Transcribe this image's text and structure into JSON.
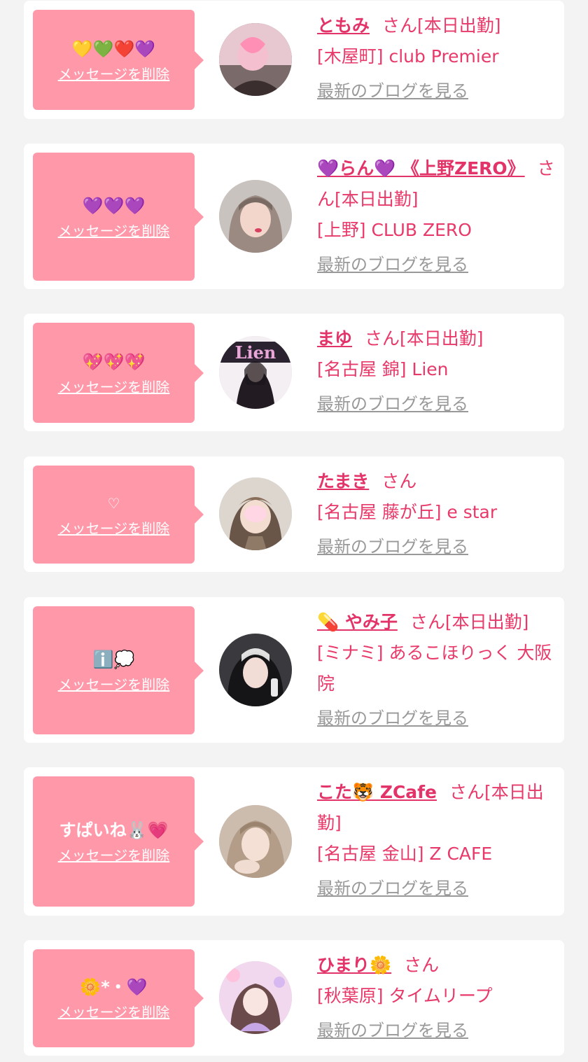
{
  "delete_label": "メッセージを削除",
  "blog_label": "最新のブログを見る",
  "cards": [
    {
      "message": "💛💚❤️💜",
      "name": "ともみ",
      "san": "さん",
      "status": "[本日出勤]",
      "shop": "[木屋町] club Premier"
    },
    {
      "message": "💜💜💜",
      "name": "💜らん💜 《上野ZERO》",
      "san": "さん",
      "status": "[本日出勤]",
      "shop": "[上野] CLUB ZERO"
    },
    {
      "message": "💖💖💖",
      "name": "まゆ",
      "san": "さん",
      "status": "[本日出勤]",
      "shop": "[名古屋 錦] Lien"
    },
    {
      "message": "♡",
      "name": "たまき",
      "san": "さん",
      "status": "",
      "shop": "[名古屋 藤が丘] e star"
    },
    {
      "message": "ℹ️💭",
      "name": "💊 やみ子",
      "san": "さん",
      "status": "[本日出勤]",
      "shop": "[ミナミ] あるこほりっく 大阪院"
    },
    {
      "message": "すぱいね🐰💗",
      "name": "こた🐯 ZCafe",
      "san": "さん",
      "status": "[本日出勤]",
      "shop": "[名古屋 金山] Z CAFE"
    },
    {
      "message": "🌼*・💜",
      "name": "ひまり🌼",
      "san": "さん",
      "status": "",
      "shop": "[秋葉原] タイムリープ"
    }
  ],
  "colors": {
    "background": "#f3f3f3",
    "bubble": "#ff99aa",
    "accent": "#e3346a",
    "muted": "#999999"
  }
}
